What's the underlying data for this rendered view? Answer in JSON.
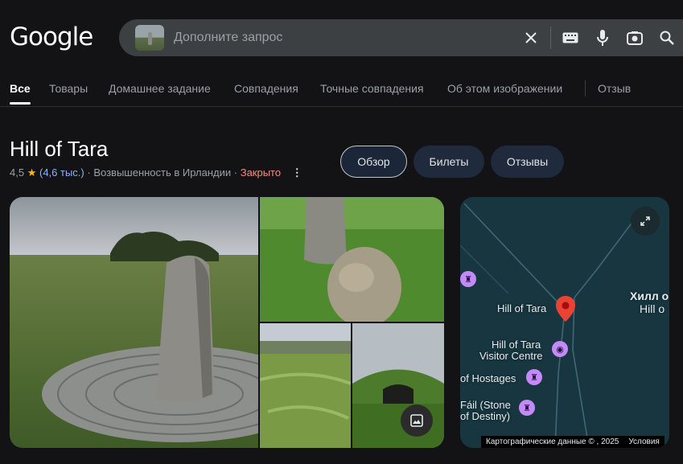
{
  "header": {
    "logo": "Google"
  },
  "search": {
    "placeholder": "Дополните запрос"
  },
  "tabs": [
    {
      "label": "Все"
    },
    {
      "label": "Товары"
    },
    {
      "label": "Домашнее задание"
    },
    {
      "label": "Совпадения"
    },
    {
      "label": "Точные совпадения"
    },
    {
      "label": "Об этом изображении"
    },
    {
      "label": "Отзыв"
    }
  ],
  "place": {
    "title": "Hill of Tara",
    "rating": "4,5",
    "reviews": "(4,6 тыс.)",
    "category": "Возвышенность в Ирландии",
    "status": "Закрыто"
  },
  "chips": [
    {
      "label": "Обзор"
    },
    {
      "label": "Билеты"
    },
    {
      "label": "Отзывы"
    }
  ],
  "map": {
    "labels": {
      "hill_of_tara": "Hill of Tara",
      "visitor_centre_1": "Hill of Tara",
      "visitor_centre_2": "Visitor Centre",
      "hostages": "of Hostages",
      "fail_1": "Fáil (Stone",
      "fail_2": "of Destiny)",
      "right_ru": "Хилл о",
      "right_en": "Hill o"
    },
    "attribution": "Картографические данные © , 2025",
    "terms": "Условия"
  },
  "colors": {
    "accent_link": "#8ab4f8",
    "closed": "#f28b82",
    "star": "#fbbc04",
    "pin": "#ea4335",
    "poi": "#c58af9"
  }
}
